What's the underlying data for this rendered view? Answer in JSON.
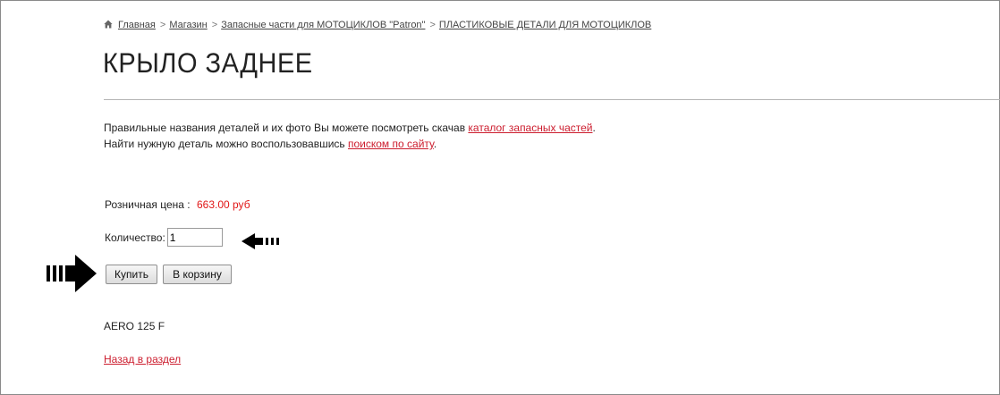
{
  "breadcrumb": {
    "items": [
      {
        "label": "Главная"
      },
      {
        "label": "Магазин"
      },
      {
        "label": "Запасные части для МОТОЦИКЛОВ \"Patron\""
      },
      {
        "label": "ПЛАСТИКОВЫЕ ДЕТАЛИ ДЛЯ МОТОЦИКЛОВ"
      }
    ],
    "separator": ">",
    "home_icon": "home-icon"
  },
  "page": {
    "title": "КРЫЛО ЗАДНЕЕ"
  },
  "info": {
    "line1_text": "Правильные названия деталей и их фото Вы можете посмотреть скачав ",
    "line1_link": "каталог запасных частей",
    "line1_end": ".",
    "line2_text": "Найти нужную деталь можно воспользовавшись ",
    "line2_link": "поиском по сайту",
    "line2_end": "."
  },
  "price": {
    "label": "Розничная цена",
    "colon": ":",
    "value": "663.00 руб"
  },
  "quantity": {
    "label": "Количество:",
    "value": "1"
  },
  "buttons": {
    "buy_label": "Купить",
    "cart_label": "В корзину"
  },
  "product": {
    "model": "AERO 125 F"
  },
  "back_link": "Назад в раздел",
  "colors": {
    "link_red": "#cc1d2e",
    "price_red": "#e11818",
    "text": "#222222",
    "arrow": "#000000"
  },
  "annotations": {
    "left_arrow_icon": "dashed-arrow-left-icon",
    "right_arrow_icon": "dashed-arrow-right-icon"
  }
}
